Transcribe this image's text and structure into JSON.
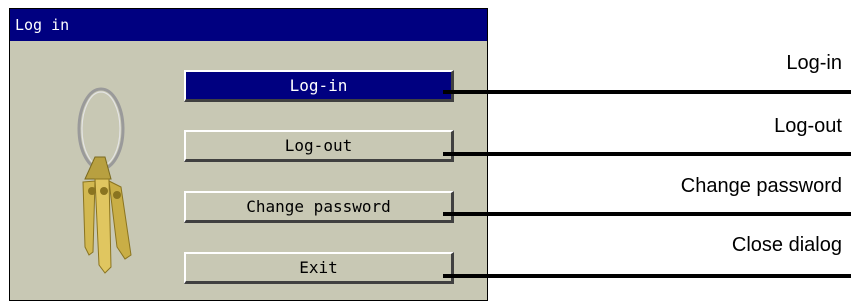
{
  "dialog": {
    "title": "Log in",
    "buttons": {
      "login": "Log-in",
      "logout": "Log-out",
      "change_password": "Change password",
      "exit": "Exit"
    }
  },
  "callouts": {
    "login": "Log-in",
    "logout": "Log-out",
    "change_password": "Change password",
    "exit": "Close dialog"
  },
  "icons": {
    "keys": "keys-icon"
  },
  "colors": {
    "titlebar": "#000080",
    "dialog_bg": "#c8c8b4",
    "active_button": "#000080"
  }
}
